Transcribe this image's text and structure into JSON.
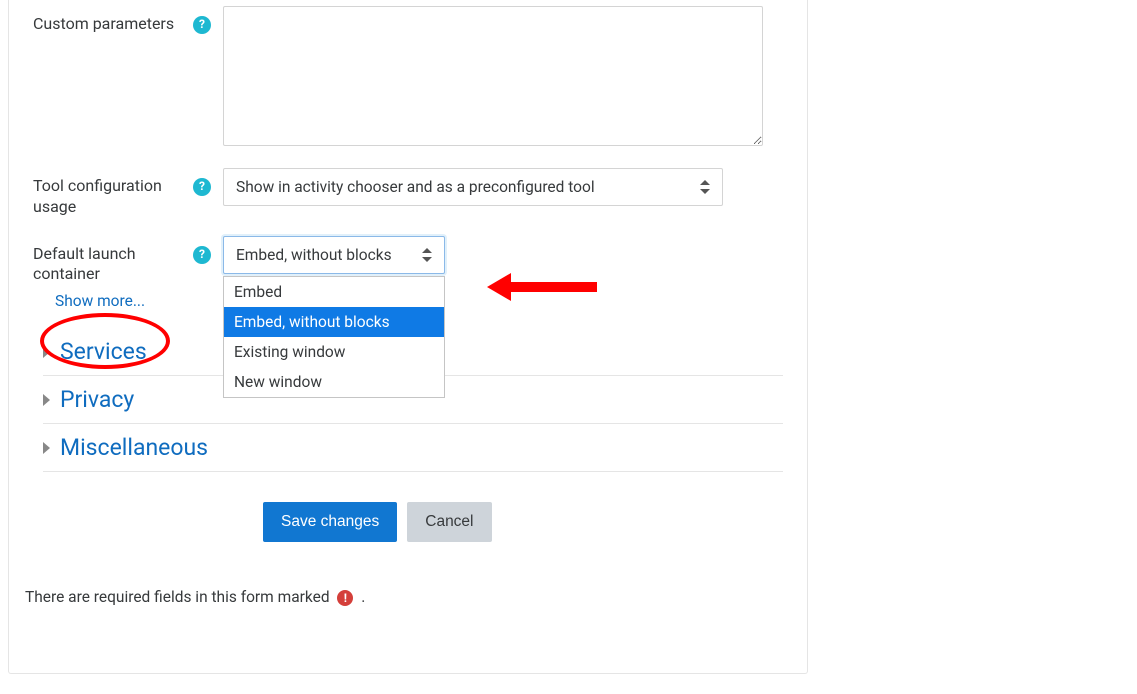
{
  "fields": {
    "custom_params": {
      "label": "Custom parameters",
      "value": ""
    },
    "tool_cfg_usage": {
      "label": "Tool configuration usage",
      "selected": "Show in activity chooser and as a preconfigured tool"
    },
    "default_launch": {
      "label": "Default launch container",
      "selected": "Embed, without blocks",
      "options": [
        "Embed",
        "Embed, without blocks",
        "Existing window",
        "New window"
      ]
    }
  },
  "show_more": "Show more...",
  "sections": [
    "Services",
    "Privacy",
    "Miscellaneous"
  ],
  "actions": {
    "save": "Save changes",
    "cancel": "Cancel"
  },
  "required_note_prefix": "There are required fields in this form marked ",
  "required_note_suffix": " ."
}
